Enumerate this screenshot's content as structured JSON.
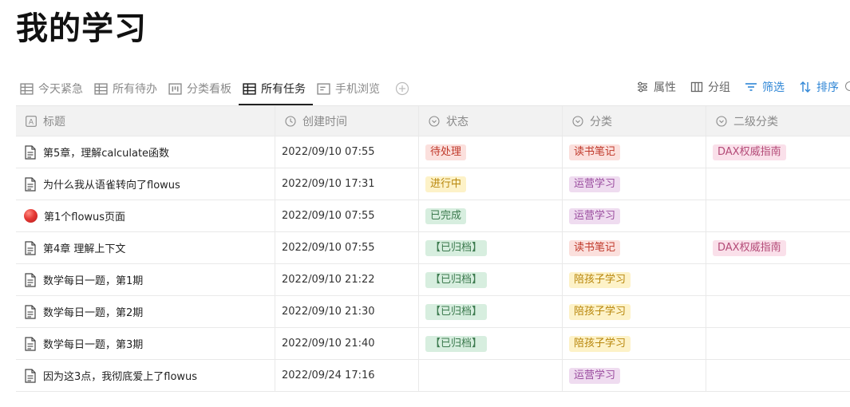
{
  "page": {
    "title": "我的学习"
  },
  "tabs": [
    {
      "label": "今天紧急",
      "icon": "table-icon",
      "active": false
    },
    {
      "label": "所有待办",
      "icon": "table-icon",
      "active": false
    },
    {
      "label": "分类看板",
      "icon": "board-icon",
      "active": false
    },
    {
      "label": "所有任务",
      "icon": "table-icon",
      "active": true
    },
    {
      "label": "手机浏览",
      "icon": "gallery-icon",
      "active": false
    }
  ],
  "toolbar": {
    "properties": "属性",
    "group": "分组",
    "filter": "筛选",
    "sort": "排序"
  },
  "columns": [
    "标题",
    "创建时间",
    "状态",
    "分类",
    "二级分类"
  ],
  "rows": [
    {
      "title": "第5章，理解calculate函数",
      "created": "2022/09/10 07:55",
      "status": "待处理",
      "category": "读书笔记",
      "subcategory": "DAX权威指南",
      "icon": "doc-icon"
    },
    {
      "title": "为什么我从语雀转向了flowus",
      "created": "2022/09/10 17:31",
      "status": "进行中",
      "category": "运营学习",
      "subcategory": "",
      "icon": "doc-icon"
    },
    {
      "title": "第1个flowus页面",
      "created": "2022/09/10 07:55",
      "status": "已完成",
      "category": "运营学习",
      "subcategory": "",
      "icon": "red-ball-icon"
    },
    {
      "title": "第4章 理解上下文",
      "created": "2022/09/10 07:55",
      "status": "【已归档】",
      "category": "读书笔记",
      "subcategory": "DAX权威指南",
      "icon": "doc-icon"
    },
    {
      "title": "数学每日一题，第1期",
      "created": "2022/09/10 21:22",
      "status": "【已归档】",
      "category": "陪孩子学习",
      "subcategory": "",
      "icon": "doc-icon"
    },
    {
      "title": "数学每日一题，第2期",
      "created": "2022/09/10 21:30",
      "status": "【已归档】",
      "category": "陪孩子学习",
      "subcategory": "",
      "icon": "doc-icon"
    },
    {
      "title": "数学每日一题，第3期",
      "created": "2022/09/10 21:40",
      "status": "【已归档】",
      "category": "陪孩子学习",
      "subcategory": "",
      "icon": "doc-icon"
    },
    {
      "title": "因为这3点，我彻底爱上了flowus",
      "created": "2022/09/24 17:16",
      "status": "",
      "category": "运营学习",
      "subcategory": "",
      "icon": "doc-icon"
    }
  ],
  "tag_colors": {
    "待处理": "red",
    "进行中": "yellow",
    "已完成": "green",
    "【已归档】": "green",
    "读书笔记": "red",
    "运营学习": "purple",
    "陪孩子学习": "yellow",
    "DAX权威指南": "pink"
  },
  "colors": {
    "accent": "#2f86d6",
    "header_bg": "#f2f2f2"
  }
}
